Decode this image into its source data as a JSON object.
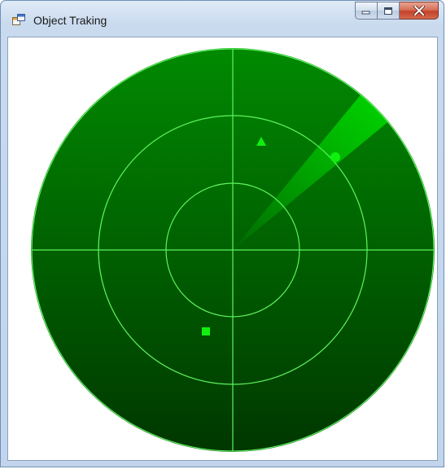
{
  "window": {
    "title": "Object Traking",
    "icons": {
      "app": "app-window-icon",
      "minimize": "minimize-icon",
      "maximize": "maximize-icon",
      "close": "close-icon"
    }
  },
  "radar": {
    "colors": {
      "background_top": "#018a01",
      "background_bottom": "#003700",
      "grid_lines": "#5ef45e",
      "sweep": "#00d000",
      "blip": "#10f010"
    },
    "sweep_heading_deg": 45,
    "sweep_width_deg": 11,
    "blips": [
      {
        "shape": "triangle"
      },
      {
        "shape": "circle"
      },
      {
        "shape": "square"
      }
    ]
  }
}
